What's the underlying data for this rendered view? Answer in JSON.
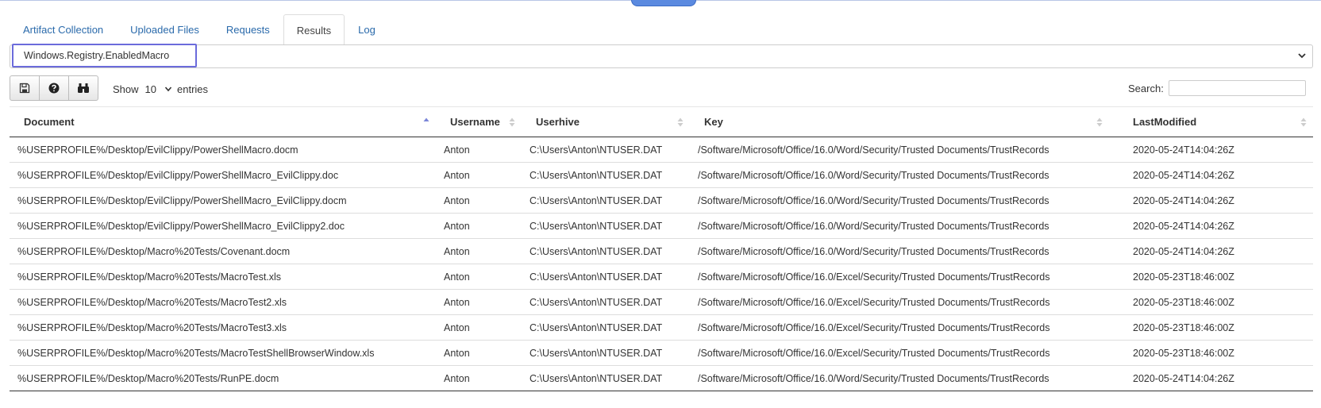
{
  "tabs": [
    {
      "label": "Artifact Collection",
      "active": false
    },
    {
      "label": "Uploaded Files",
      "active": false
    },
    {
      "label": "Requests",
      "active": false
    },
    {
      "label": "Results",
      "active": true
    },
    {
      "label": "Log",
      "active": false
    }
  ],
  "artifact_select": {
    "value": "Windows.Registry.EnabledMacro"
  },
  "toolbar": {
    "buttons": [
      {
        "icon": "save-icon"
      },
      {
        "icon": "help-icon"
      },
      {
        "icon": "binoculars-icon"
      }
    ],
    "show_label": "Show",
    "entries_value": "10",
    "entries_label": "entries",
    "search_label": "Search:"
  },
  "table": {
    "columns": [
      {
        "label": "Document",
        "sort": "ascending"
      },
      {
        "label": "Username",
        "sort": "none"
      },
      {
        "label": "Userhive",
        "sort": "none"
      },
      {
        "label": "Key",
        "sort": "none"
      },
      {
        "label": "LastModified",
        "sort": "none"
      }
    ],
    "rows": [
      [
        "%USERPROFILE%/Desktop/EvilClippy/PowerShellMacro.docm",
        "Anton",
        "C:\\Users\\Anton\\NTUSER.DAT",
        "/Software/Microsoft/Office/16.0/Word/Security/Trusted Documents/TrustRecords",
        "2020-05-24T14:04:26Z"
      ],
      [
        "%USERPROFILE%/Desktop/EvilClippy/PowerShellMacro_EvilClippy.doc",
        "Anton",
        "C:\\Users\\Anton\\NTUSER.DAT",
        "/Software/Microsoft/Office/16.0/Word/Security/Trusted Documents/TrustRecords",
        "2020-05-24T14:04:26Z"
      ],
      [
        "%USERPROFILE%/Desktop/EvilClippy/PowerShellMacro_EvilClippy.docm",
        "Anton",
        "C:\\Users\\Anton\\NTUSER.DAT",
        "/Software/Microsoft/Office/16.0/Word/Security/Trusted Documents/TrustRecords",
        "2020-05-24T14:04:26Z"
      ],
      [
        "%USERPROFILE%/Desktop/EvilClippy/PowerShellMacro_EvilClippy2.doc",
        "Anton",
        "C:\\Users\\Anton\\NTUSER.DAT",
        "/Software/Microsoft/Office/16.0/Word/Security/Trusted Documents/TrustRecords",
        "2020-05-24T14:04:26Z"
      ],
      [
        "%USERPROFILE%/Desktop/Macro%20Tests/Covenant.docm",
        "Anton",
        "C:\\Users\\Anton\\NTUSER.DAT",
        "/Software/Microsoft/Office/16.0/Word/Security/Trusted Documents/TrustRecords",
        "2020-05-24T14:04:26Z"
      ],
      [
        "%USERPROFILE%/Desktop/Macro%20Tests/MacroTest.xls",
        "Anton",
        "C:\\Users\\Anton\\NTUSER.DAT",
        "/Software/Microsoft/Office/16.0/Excel/Security/Trusted Documents/TrustRecords",
        "2020-05-23T18:46:00Z"
      ],
      [
        "%USERPROFILE%/Desktop/Macro%20Tests/MacroTest2.xls",
        "Anton",
        "C:\\Users\\Anton\\NTUSER.DAT",
        "/Software/Microsoft/Office/16.0/Excel/Security/Trusted Documents/TrustRecords",
        "2020-05-23T18:46:00Z"
      ],
      [
        "%USERPROFILE%/Desktop/Macro%20Tests/MacroTest3.xls",
        "Anton",
        "C:\\Users\\Anton\\NTUSER.DAT",
        "/Software/Microsoft/Office/16.0/Excel/Security/Trusted Documents/TrustRecords",
        "2020-05-23T18:46:00Z"
      ],
      [
        "%USERPROFILE%/Desktop/Macro%20Tests/MacroTestShellBrowserWindow.xls",
        "Anton",
        "C:\\Users\\Anton\\NTUSER.DAT",
        "/Software/Microsoft/Office/16.0/Excel/Security/Trusted Documents/TrustRecords",
        "2020-05-23T18:46:00Z"
      ],
      [
        "%USERPROFILE%/Desktop/Macro%20Tests/RunPE.docm",
        "Anton",
        "C:\\Users\\Anton\\NTUSER.DAT",
        "/Software/Microsoft/Office/16.0/Word/Security/Trusted Documents/TrustRecords",
        "2020-05-24T14:04:26Z"
      ]
    ]
  },
  "colors": {
    "link": "#2a6aab",
    "focus_border": "#6b6bdb",
    "sort_active": "#7b86d8",
    "sort_inactive": "#cccccc"
  }
}
